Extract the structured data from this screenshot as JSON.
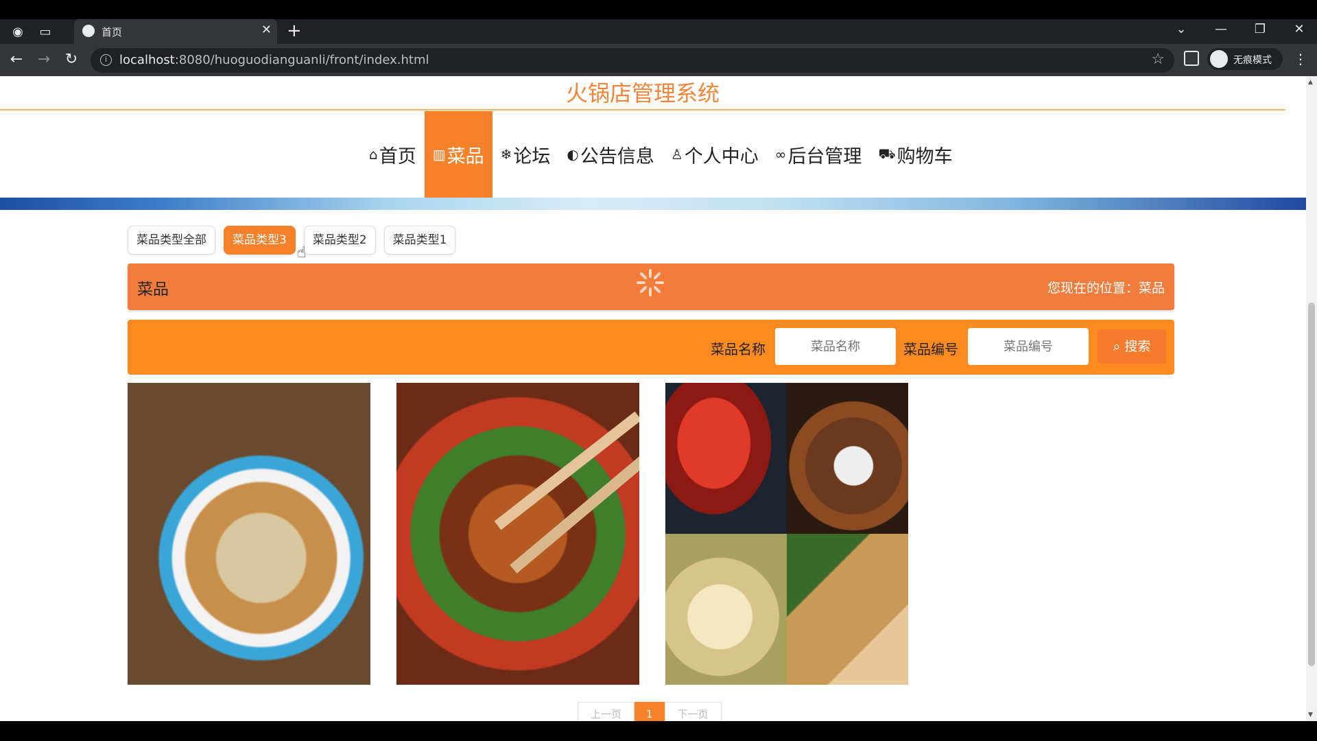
{
  "browser": {
    "tab_title": "首页",
    "url_host": "localhost",
    "url_rest": ":8080/huoguodianguanli/front/index.html",
    "incognito_label": "无痕模式"
  },
  "site": {
    "title": "火锅店管理系统",
    "accent_color": "#f5822a",
    "nav": [
      {
        "icon": "home-icon",
        "glyph": "⌂",
        "label": "首页",
        "active": false
      },
      {
        "icon": "dish-icon",
        "glyph": "▥",
        "label": "菜品",
        "active": true
      },
      {
        "icon": "snowflake-icon",
        "glyph": "❄",
        "label": "论坛",
        "active": false
      },
      {
        "icon": "palette-icon",
        "glyph": "◐",
        "label": "公告信息",
        "active": false
      },
      {
        "icon": "user-icon",
        "glyph": "♙",
        "label": "个人中心",
        "active": false
      },
      {
        "icon": "link-icon",
        "glyph": "∞",
        "label": "后台管理",
        "active": false
      },
      {
        "icon": "cart-icon",
        "glyph": "⛟",
        "label": "购物车",
        "active": false
      }
    ]
  },
  "filters": [
    {
      "label": "菜品类型全部",
      "active": false
    },
    {
      "label": "菜品类型3",
      "active": true
    },
    {
      "label": "菜品类型2",
      "active": false
    },
    {
      "label": "菜品类型1",
      "active": false
    }
  ],
  "section": {
    "title": "菜品",
    "location": "您现在的位置：菜品"
  },
  "search": {
    "name_label": "菜品名称",
    "name_placeholder": "菜品名称",
    "code_label": "菜品编号",
    "code_placeholder": "菜品编号",
    "button_label": "搜索"
  },
  "pagination": {
    "prev": "上一页",
    "current": "1",
    "next": "下一页"
  }
}
